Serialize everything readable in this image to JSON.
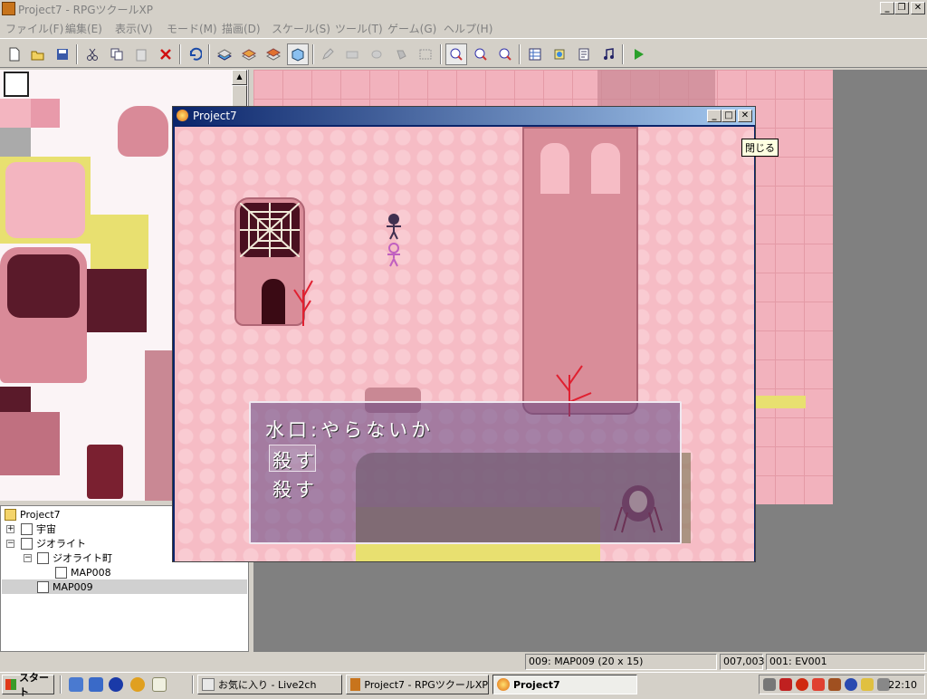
{
  "window": {
    "title": "Project7 - RPGツクールXP"
  },
  "menu": [
    "ファイル(F)",
    "編集(E)",
    "表示(V)",
    "モード(M)",
    "描画(D)",
    "スケール(S)",
    "ツール(T)",
    "ゲーム(G)",
    "ヘルプ(H)"
  ],
  "toolbar_icons": [
    "new-project",
    "open-project",
    "save-project",
    "cut",
    "copy",
    "paste",
    "delete",
    "undo",
    "layer-1",
    "layer-2",
    "layer-3",
    "event-layer",
    "pencil",
    "rectangle",
    "ellipse",
    "fill",
    "select",
    "zoom-1-1",
    "zoom-1-2",
    "zoom-1-4",
    "database",
    "material-base",
    "script-editor",
    "sound-test",
    "playtest"
  ],
  "tree": {
    "root": "Project7",
    "items": [
      {
        "label": "宇宙"
      },
      {
        "label": "ジオライト"
      },
      {
        "label": "ジオライト町"
      },
      {
        "label": "MAP008"
      },
      {
        "label": "MAP009"
      }
    ]
  },
  "game_window": {
    "title": "Project7"
  },
  "tooltip": "閉じる",
  "message": {
    "line1": "水口:やらないか",
    "choice1": "殺す",
    "choice2": "殺す"
  },
  "status": {
    "map": "009: MAP009 (20 x 15)",
    "coords": "007,003",
    "event": "001: EV001"
  },
  "taskbar": {
    "start": "スタート",
    "tasks": [
      "お気に入り - Live2ch",
      "Project7 - RPGツクールXP",
      "Project7"
    ],
    "clock": "22:10"
  }
}
